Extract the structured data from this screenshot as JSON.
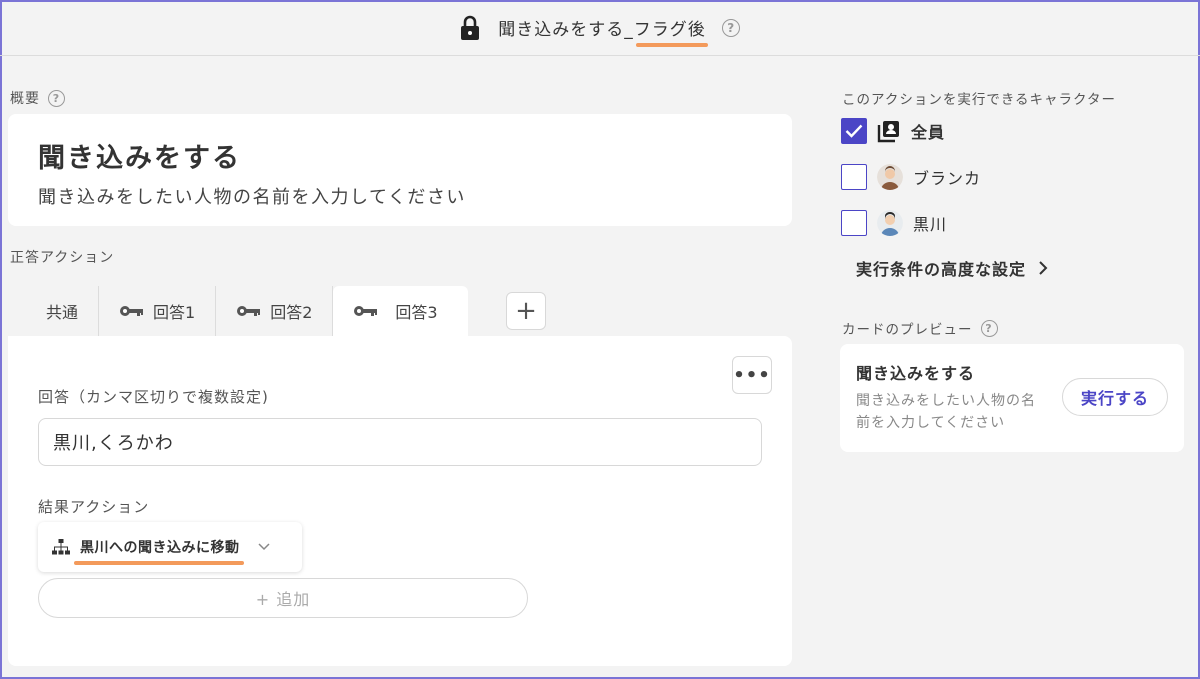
{
  "header": {
    "title_main": "聞き込みをする_",
    "title_flag": "フラグ後",
    "help": "?"
  },
  "summary": {
    "label": "概要",
    "help": "?",
    "title": "聞き込みをする",
    "description": "聞き込みをしたい人物の名前を入力してください"
  },
  "correct_actions": {
    "label": "正答アクション",
    "tabs": [
      {
        "label": "共通"
      },
      {
        "label": "回答1"
      },
      {
        "label": "回答2"
      },
      {
        "label": "回答3"
      }
    ],
    "add_tab": "+",
    "more": "•••",
    "answer_label": "回答（カンマ区切りで複数設定)",
    "answer_value": "黒川,くろかわ",
    "result_label": "結果アクション",
    "result_value": "黒川への聞き込みに移動",
    "add_button": "+ 追加"
  },
  "characters": {
    "label": "このアクションを実行できるキャラクター",
    "items": [
      {
        "name": "全員",
        "checked": true
      },
      {
        "name": "ブランカ",
        "checked": false
      },
      {
        "name": "黒川",
        "checked": false
      }
    ],
    "advanced": "実行条件の高度な設定",
    "advanced_arrow": "›"
  },
  "preview": {
    "label": "カードのプレビュー",
    "help": "?",
    "title": "聞き込みをする",
    "desc_line1": "聞き込みをしたい人物の名",
    "desc_line2": "前を入力してください",
    "run_button": "実行する"
  },
  "colors": {
    "accent": "#4b45c6",
    "highlight": "#f39a5b",
    "background": "#f3f3f3"
  }
}
